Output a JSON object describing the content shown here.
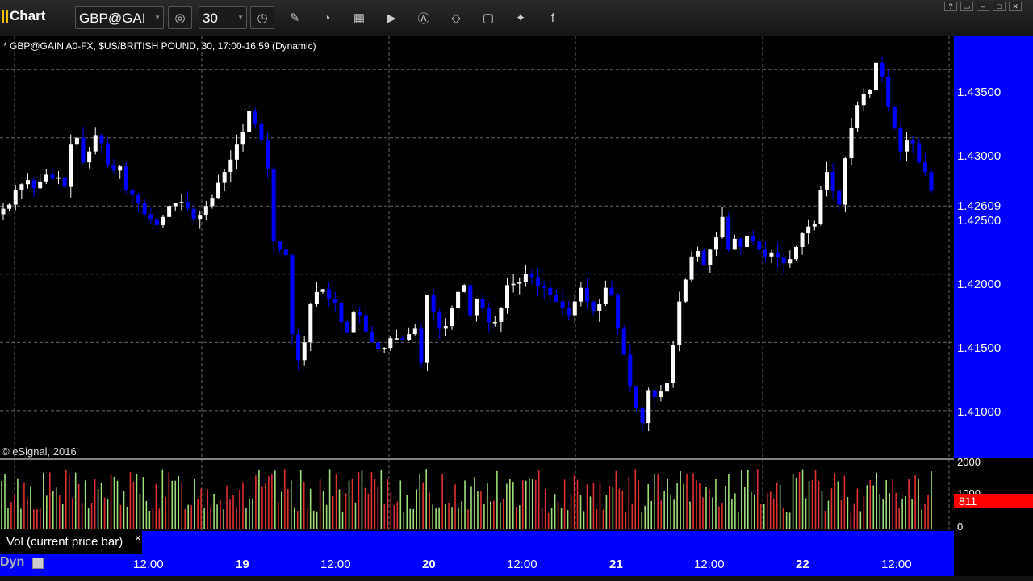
{
  "toolbar": {
    "app_title": "Chart",
    "symbol": "GBP@GAI",
    "interval": "30",
    "icons": [
      "symbol-link-icon",
      "clock-icon",
      "pencil-icon",
      "speedometer-icon",
      "calendar-icon",
      "play-icon",
      "alert-icon",
      "eraser-icon",
      "comment-icon",
      "twitter-icon",
      "facebook-icon"
    ],
    "window_controls": [
      "?",
      "▭",
      "–",
      "□",
      "✕"
    ]
  },
  "chart_header": "* GBP@GAIN A0-FX, $US/BRITISH POUND, 30, 17:00-16:59 (Dynamic)",
  "copyright": "© eSignal, 2016",
  "price_axis": {
    "labels": [
      "1.43500",
      "1.43000",
      "1.42500",
      "1.42000",
      "1.41500",
      "1.41000"
    ],
    "last_price": "1.42609"
  },
  "volume": {
    "axis_labels": [
      "2000",
      "1000",
      "0"
    ],
    "current": "811",
    "title": "Vol (current price bar)",
    "close": "×"
  },
  "time_axis": {
    "labels": [
      {
        "text": "12:00",
        "day": false
      },
      {
        "text": "19",
        "day": true
      },
      {
        "text": "12:00",
        "day": false
      },
      {
        "text": "20",
        "day": true
      },
      {
        "text": "12:00",
        "day": false
      },
      {
        "text": "21",
        "day": true
      },
      {
        "text": "12:00",
        "day": false
      },
      {
        "text": "22",
        "day": true
      },
      {
        "text": "12:00",
        "day": false
      }
    ],
    "mode": "Dyn"
  },
  "colors": {
    "up": "#ffffff",
    "down": "#0000ff",
    "vol_up": "#9de07a",
    "vol_down": "#e03030",
    "axis_bg": "#0000ff"
  },
  "chart_data": {
    "type": "candlestick",
    "title": "GBP@GAIN A0-FX, $US/BRITISH POUND, 30",
    "ylim": [
      1.4065,
      1.4375
    ],
    "close": [
      1.4248,
      1.4251,
      1.4262,
      1.4266,
      1.4269,
      1.4263,
      1.4268,
      1.4273,
      1.427,
      1.4271,
      1.4264,
      1.4295,
      1.43,
      1.4282,
      1.429,
      1.4302,
      1.4296,
      1.428,
      1.4276,
      1.4279,
      1.4262,
      1.4258,
      1.4252,
      1.4244,
      1.424,
      1.4236,
      1.4242,
      1.425,
      1.4252,
      1.4253,
      1.4248,
      1.424,
      1.4243,
      1.425,
      1.4256,
      1.4267,
      1.4275,
      1.4284,
      1.4295,
      1.4304,
      1.432,
      1.431,
      1.4298,
      1.4277,
      1.4224,
      1.4218,
      1.4214,
      1.4156,
      1.4137,
      1.415,
      1.4178,
      1.4187,
      1.4189,
      1.4182,
      1.4179,
      1.4165,
      1.4157,
      1.4172,
      1.417,
      1.4158,
      1.415,
      1.4145,
      1.4146,
      1.4153,
      1.4153,
      1.4152,
      1.4156,
      1.416,
      1.4135,
      1.4185,
      1.4172,
      1.416,
      1.4162,
      1.4175,
      1.4187,
      1.4192,
      1.417,
      1.4182,
      1.4175,
      1.4165,
      1.4165,
      1.4175,
      1.4192,
      1.4193,
      1.4194,
      1.42,
      1.4198,
      1.4191,
      1.419,
      1.4185,
      1.418,
      1.4175,
      1.417,
      1.418,
      1.419,
      1.418,
      1.4173,
      1.4178,
      1.419,
      1.4185,
      1.416,
      1.4141,
      1.4118,
      1.4102,
      1.4091,
      1.4115,
      1.411,
      1.4114,
      1.412,
      1.4148,
      1.418,
      1.4196,
      1.4213,
      1.4217,
      1.4207,
      1.4218,
      1.4227,
      1.4242,
      1.4218,
      1.4226,
      1.422,
      1.4228,
      1.4224,
      1.4218,
      1.4213,
      1.4216,
      1.4212,
      1.4208,
      1.4211,
      1.422,
      1.423,
      1.4235,
      1.4237,
      1.4262,
      1.4275,
      1.4261,
      1.4251,
      1.4285,
      1.4307,
      1.4324,
      1.4332,
      1.4335,
      1.4355,
      1.4345,
      1.4323,
      1.4307,
      1.429,
      1.4298,
      1.4296,
      1.4282,
      1.4275,
      1.4261
    ]
  }
}
